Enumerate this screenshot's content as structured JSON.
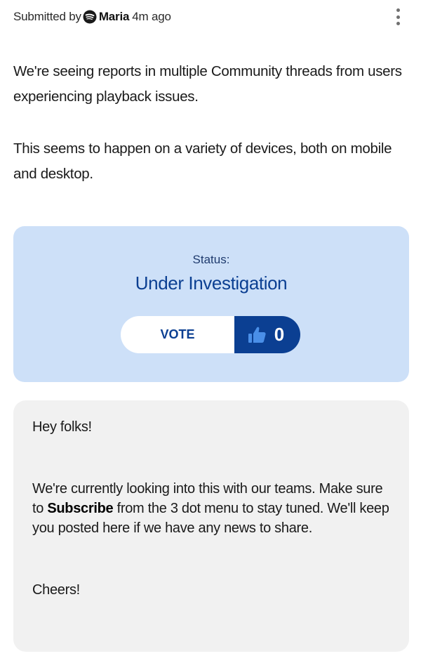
{
  "header": {
    "submitted_by": "Submitted by",
    "author": "Maria",
    "time_ago": "4m ago",
    "brand_icon": "spotify-logo-icon",
    "menu_icon": "more-vertical-icon"
  },
  "post": {
    "paragraph_1": "We're seeing reports in multiple Community threads from users experiencing playback issues.",
    "paragraph_2": "This seems to happen on a variety of devices, both on mobile and desktop."
  },
  "status": {
    "label": "Status:",
    "value": "Under Investigation",
    "vote_label": "VOTE",
    "vote_count": "0",
    "vote_icon": "thumbs-up-icon"
  },
  "reply": {
    "greeting": "Hey folks!",
    "body_prefix": "We're currently looking into this with our teams. Make sure to ",
    "body_bold": "Subscribe",
    "body_suffix": " from the 3 dot menu to stay tuned. We'll keep you posted here if we have any news to share.",
    "signoff": "Cheers!"
  },
  "colors": {
    "status_card_bg": "#cde0f8",
    "accent_blue": "#0b3f92",
    "reply_card_bg": "#f1f1f1"
  }
}
